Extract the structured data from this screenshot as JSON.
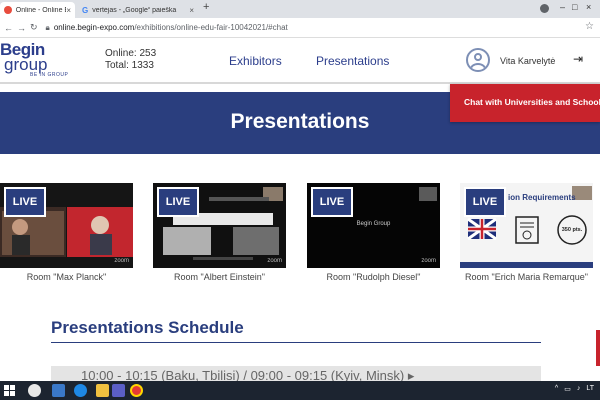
{
  "browser": {
    "tabs": [
      {
        "title": "Online - Online Edu",
        "active": true,
        "favicon_color": "#e84c3d"
      },
      {
        "title": "vertėjas - „Google“ paieška",
        "active": false,
        "favicon_color": "#4285f4"
      }
    ],
    "new_tab_icon": "+",
    "url_host": "online.begin-expo.com",
    "url_path": "/exhibitions/online-edu-fair-10042021/#chat"
  },
  "header": {
    "logo_line1": "Begin",
    "logo_line2": "group",
    "logo_line3": "BE IN GROUP",
    "online": "Online: 253",
    "total": "Total: 1333",
    "nav": [
      "Exhibitors",
      "Presentations"
    ],
    "username": "Vita Karvelytė"
  },
  "banner": {
    "title": "Presentations",
    "chat_button": "Chat with Universities and Schools"
  },
  "rooms": [
    {
      "label": "Room \"Max Planck\"",
      "live": "LIVE",
      "tag": "zoom"
    },
    {
      "label": "Room \"Albert Einstein\"",
      "live": "LIVE",
      "tag": "zoom"
    },
    {
      "label": "Room \"Rudolph Diesel\"",
      "live": "LIVE",
      "tag": "zoom",
      "center_text": "Begin Group"
    },
    {
      "label": "Room \"Erich Maria Remarque\"",
      "live": "LIVE",
      "slide_title": "ion Requirements",
      "slide_pts": "350 pts."
    }
  ],
  "schedule": {
    "title": "Presentations Schedule",
    "first_row": "10:00 - 10:15 (Baku, Tbilisi) / 09:00 - 09:15 (Kyiv, Minsk) ▸"
  },
  "taskbar": {
    "tray_lang": "LT"
  },
  "colors": {
    "brand_blue": "#2a3e7e",
    "accent_red": "#c8232c"
  }
}
